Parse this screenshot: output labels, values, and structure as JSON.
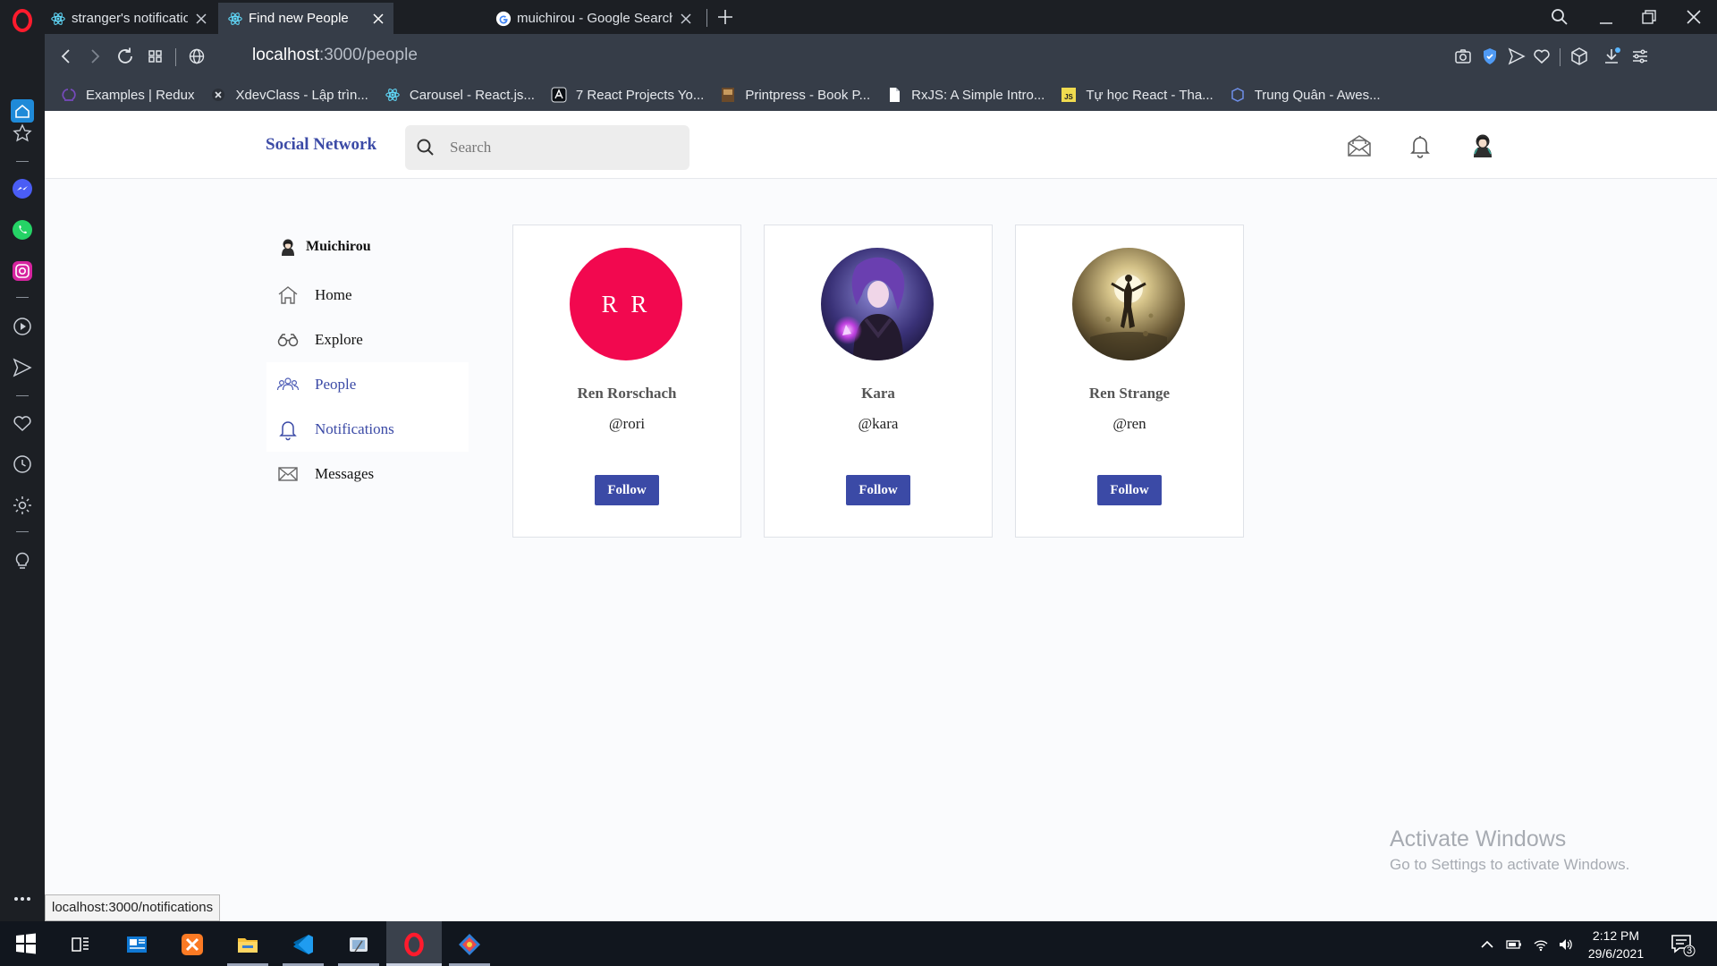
{
  "browser": {
    "tabs": [
      {
        "title": "stranger's notifications",
        "icon": "react-icon",
        "active": false
      },
      {
        "title": "Find new People",
        "icon": "react-icon",
        "active": true
      },
      {
        "title": "muichirou - Google Search",
        "icon": "google-icon",
        "active": false
      }
    ],
    "url_host": "localhost",
    "url_path": ":3000/people",
    "bookmarks": [
      {
        "label": "Examples | Redux",
        "icon": "redux-icon"
      },
      {
        "label": "XdevClass - Lập trìn...",
        "icon": "xdevclass-icon"
      },
      {
        "label": "Carousel - React.js...",
        "icon": "react-icon"
      },
      {
        "label": "7 React Projects Yo...",
        "icon": "angular-icon"
      },
      {
        "label": "Printpress - Book P...",
        "icon": "book-icon"
      },
      {
        "label": "RxJS: A Simple Intro...",
        "icon": "document-icon"
      },
      {
        "label": "Tự học React - Tha...",
        "icon": "js-icon"
      },
      {
        "label": "Trung Quân - Awes...",
        "icon": "sketch-icon"
      }
    ]
  },
  "app": {
    "brand": "Social Network",
    "search_placeholder": "Search",
    "current_user": "Muichirou",
    "nav": [
      {
        "label": "Home",
        "icon": "home-icon"
      },
      {
        "label": "Explore",
        "icon": "binoculars-icon"
      },
      {
        "label": "People",
        "icon": "people-icon"
      },
      {
        "label": "Notifications",
        "icon": "bell-icon"
      },
      {
        "label": "Messages",
        "icon": "envelope-icon"
      }
    ],
    "people": [
      {
        "name": "Ren Rorschach",
        "handle": "@rori",
        "initials": "R R",
        "button": "Follow",
        "avatar_color": "#f2084f"
      },
      {
        "name": "Kara",
        "handle": "@kara",
        "button": "Follow",
        "avatar": "purple-haired-character-portrait"
      },
      {
        "name": "Ren Strange",
        "handle": "@ren",
        "button": "Follow",
        "avatar": "glowing-figure-portrait"
      }
    ]
  },
  "watermark": {
    "title": "Activate Windows",
    "subtitle": "Go to Settings to activate Windows."
  },
  "status_link": "localhost:3000/notifications",
  "taskbar": {
    "time": "2:12 PM",
    "date": "29/6/2021",
    "notification_count": "3"
  },
  "colors": {
    "brand": "#3b4aa6",
    "avatar_red": "#f2084f",
    "chrome_dark": "#1c1f24",
    "chrome_mid": "#363d48"
  }
}
